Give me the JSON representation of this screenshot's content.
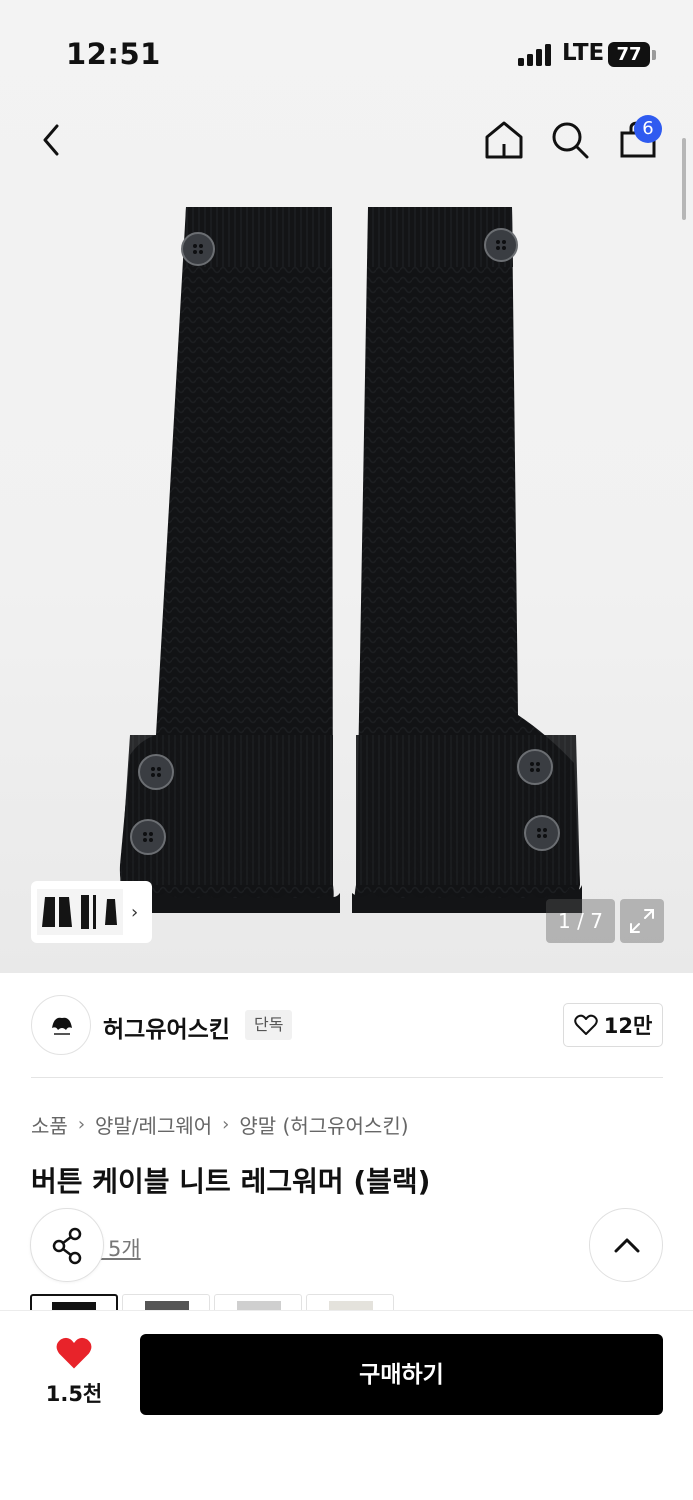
{
  "status_bar": {
    "time": "12:51",
    "network": "LTE",
    "battery": "77"
  },
  "header": {
    "cart_count": "6"
  },
  "gallery": {
    "counter": "1 / 7"
  },
  "brand": {
    "name": "허그유어스킨",
    "badge": "단독",
    "likes": "12만"
  },
  "breadcrumb": [
    "소품",
    "양말/레그웨어",
    "양말 (허그유어스킨)"
  ],
  "product": {
    "title": "버튼 케이블 니트 레그워머 (블랙)",
    "reviews": "기 5개"
  },
  "bottom": {
    "wish_count": "1.5천",
    "buy_label": "구매하기"
  },
  "colors": {
    "accent": "#2f5bf0",
    "heart": "#e8232a",
    "buy_button": "#000000"
  }
}
